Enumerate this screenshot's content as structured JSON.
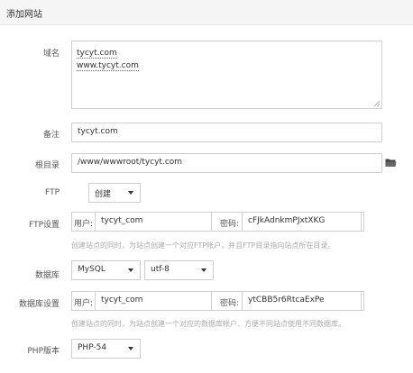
{
  "dialog": {
    "title": "添加网站"
  },
  "form": {
    "domain": {
      "label": "域名",
      "lines": [
        "tycyt.com",
        "www.tycyt.com"
      ]
    },
    "remark": {
      "label": "备注",
      "value": "tycyt.com"
    },
    "root": {
      "label": "根目录",
      "value": "/www/wwwroot/tycyt.com",
      "icon": "folder-icon"
    },
    "ftp": {
      "label": "FTP",
      "selected": "创建"
    },
    "ftp_settings": {
      "label": "FTP设置",
      "user_label": "用户:",
      "user_value": "tycyt_com",
      "password_label": "密码:",
      "password_value": "cFJkAdnkmPJxtXKG",
      "hint": "创建站点的同时，为站点创建一个对应FTP帐户，并且FTP目录指向站点所在目录。"
    },
    "database": {
      "label": "数据库",
      "engine": "MySQL",
      "charset": "utf-8"
    },
    "db_settings": {
      "label": "数据库设置",
      "user_label": "用户:",
      "user_value": "tycyt_com",
      "password_label": "密码:",
      "password_value": "ytCBB5r6RtcaExPe",
      "hint": "创建站点的同时，为站点创建一个对应的数据库帐户，方便不同站点使用不同数据库。"
    },
    "php": {
      "label": "PHP版本",
      "selected": "PHP-54"
    }
  },
  "colors": {
    "border": "#cfcfcf",
    "hint": "#aaaaaa",
    "title_bg": "#f5f5f5"
  }
}
